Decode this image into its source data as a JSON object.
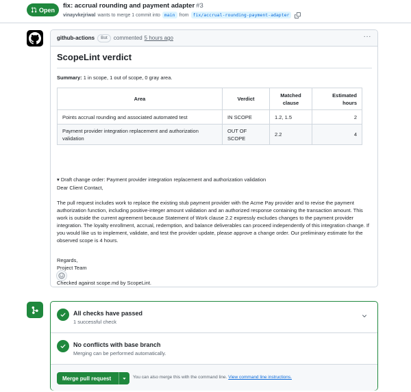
{
  "header": {
    "state": "Open",
    "title": "fix: accrual rounding and payment adapter",
    "number": "#3",
    "author": "vinayvkejriwal",
    "merge_text": "wants to merge 1 commit into",
    "base_branch": "main",
    "from_text": "from",
    "head_branch": "fix/accrual-rounding-payment-adapter"
  },
  "comment": {
    "actor": "github-actions",
    "badge": "Bot",
    "commented": "commented",
    "time": "5 hours ago",
    "heading": "ScopeLint verdict",
    "summary_label": "Summary:",
    "summary_text": "1 in scope, 1 out of scope, 0 gray area.",
    "table": {
      "headers": [
        "Area",
        "Verdict",
        "Matched clause",
        "Estimated hours"
      ],
      "rows": [
        [
          "Points accrual rounding and associated automated test",
          "IN SCOPE",
          "1.2, 1.5",
          "2"
        ],
        [
          "Payment provider integration replacement and authorization validation",
          "OUT OF SCOPE",
          "2.2",
          "4"
        ]
      ]
    },
    "details_summary": "▾ Draft change order: Payment provider integration replacement and authorization validation",
    "greeting": "Dear Client Contact,",
    "paragraph": "The pull request includes work to replace the existing stub payment provider with the Acme Pay provider and to revise the payment authorization function, including positive-integer amount validation and an authorized response containing the transaction amount. This work is outside the current agreement because Statement of Work clause 2.2 expressly excludes changes to the payment provider integration. The loyalty enrollment, accrual, redemption, and balance deliverables can proceed independently of this integration change. If you would like us to implement, validate, and test the provider update, please approve a change order. Our preliminary estimate for the observed scope is 4 hours.",
    "regards": "Regards,",
    "team": "Project Team",
    "footer": "Checked against scope.md by ScopeLint."
  },
  "merge": {
    "checks_title": "All checks have passed",
    "checks_sub": "1 successful check",
    "conflicts_title": "No conflicts with base branch",
    "conflicts_sub": "Merging can be performed automatically.",
    "button": "Merge pull request",
    "cli_text": "You can also merge this with the command line.",
    "cli_link": "View command line instructions."
  },
  "colors": {
    "success": "#1f883d",
    "link": "#0969da",
    "border": "#d0d7de"
  }
}
